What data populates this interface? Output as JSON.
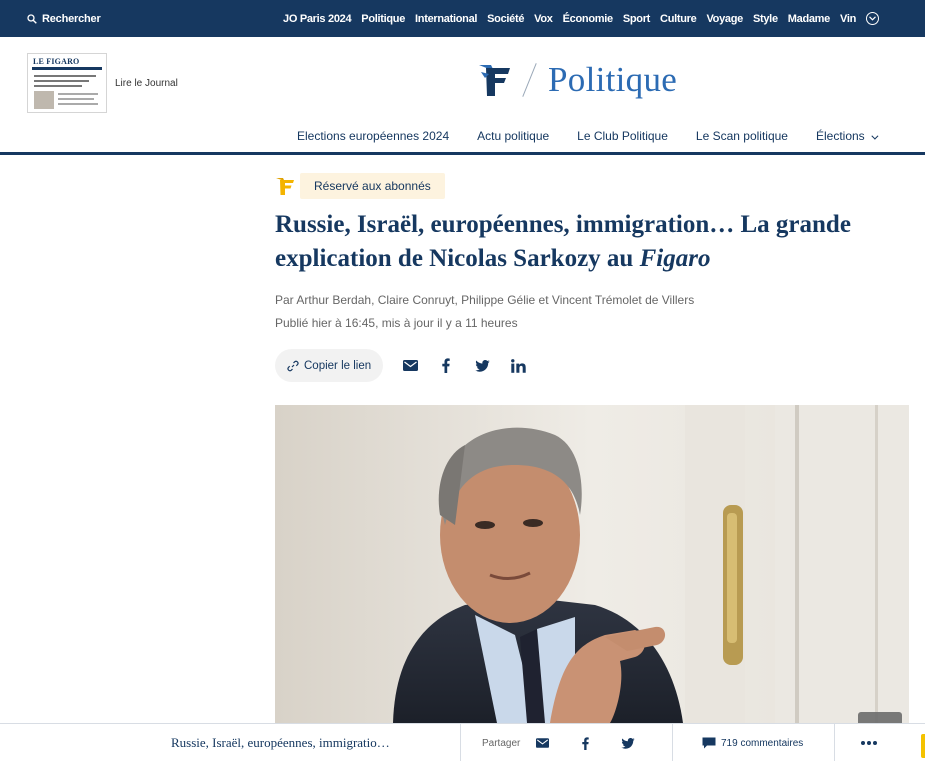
{
  "topbar": {
    "search_label": "Rechercher",
    "nav": [
      "JO Paris 2024",
      "Politique",
      "International",
      "Société",
      "Vox",
      "Économie",
      "Sport",
      "Culture",
      "Voyage",
      "Style",
      "Madame",
      "Vin"
    ]
  },
  "journal": {
    "thumb_masthead": "LE FIGARO",
    "label": "Lire le Journal"
  },
  "brand": {
    "section": "Politique"
  },
  "subnav": {
    "items": [
      "Elections européennes 2024",
      "Actu politique",
      "Le Club Politique",
      "Le Scan politique",
      "Élections"
    ]
  },
  "article": {
    "badge": "Réservé aux abonnés",
    "title_main": "Russie, Israël, européennes, immigration… La grande explication de Nicolas Sarkozy au ",
    "title_em": "Figaro",
    "by": "Par",
    "authors": [
      "Arthur Berdah",
      "Claire Conruyt",
      "Philippe Gélie",
      "Vincent Trémolet de Villers"
    ],
    "sep_comma": ",",
    "sep_and": "et",
    "published": "Publié hier à 16:45, mis à jour il y a 11 heures",
    "copy_link": "Copier le lien"
  },
  "footer": {
    "title": "Russie, Israël, européennes, immigratio…",
    "share_label": "Partager",
    "comments": "719 commentaires"
  },
  "colors": {
    "navy": "#163860",
    "accent_blue": "#2c6bb3",
    "premium_bg": "#fdf3df",
    "gold": "#f4c200"
  }
}
